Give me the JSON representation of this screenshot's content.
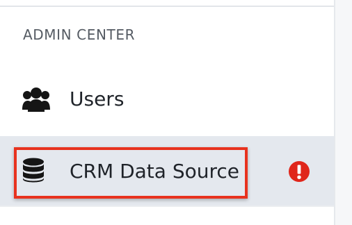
{
  "sidebar": {
    "section_heading": "ADMIN CENTER",
    "items": [
      {
        "label": "Users",
        "icon": "users-icon",
        "selected": false
      },
      {
        "label": "CRM Data Source",
        "icon": "database-icon",
        "selected": true,
        "status_icon": "error-alert-icon"
      }
    ]
  },
  "colors": {
    "selected_row": "#e4e8ee",
    "highlight_outline": "#e8321e",
    "alert": "#e0261b",
    "text": "#1f2329",
    "heading": "#555b63"
  }
}
